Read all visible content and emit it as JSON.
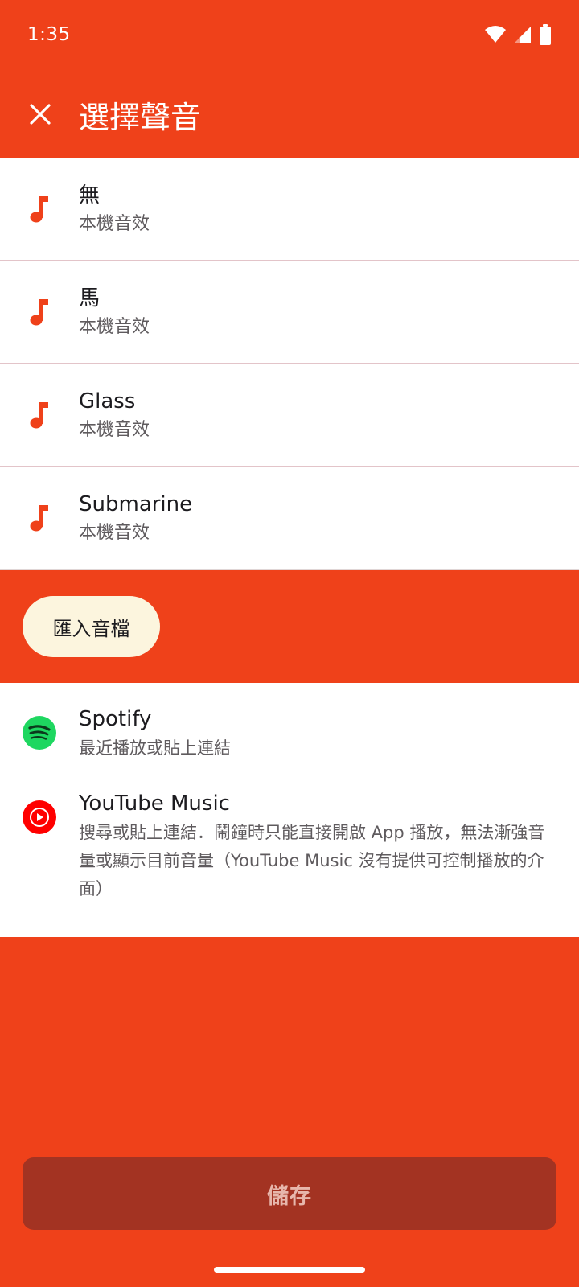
{
  "status_bar": {
    "time": "1:35"
  },
  "top_bar": {
    "title": "選擇聲音"
  },
  "sound_list": [
    {
      "title": "無",
      "subtitle": "本機音效"
    },
    {
      "title": "馬",
      "subtitle": "本機音效"
    },
    {
      "title": "Glass",
      "subtitle": "本機音效"
    },
    {
      "title": "Submarine",
      "subtitle": "本機音效"
    }
  ],
  "import_button": {
    "label": "匯入音檔"
  },
  "streaming": {
    "spotify": {
      "title": "Spotify",
      "subtitle": "最近播放或貼上連結"
    },
    "youtube_music": {
      "title": "YouTube Music",
      "subtitle": "搜尋或貼上連結．鬧鐘時只能直接開啟 App 播放，無法漸強音量或顯示目前音量（YouTube Music 沒有提供可控制播放的介面）"
    }
  },
  "save_button": {
    "label": "儲存"
  },
  "colors": {
    "primary": "#EF411A",
    "save_button": "#A33322",
    "import_button": "#FCF5DE",
    "spotify": "#1ED760",
    "youtube": "#FF0000"
  },
  "icons": {
    "close": "close-icon",
    "sound": "music-note-icon",
    "spotify": "spotify-icon",
    "youtube_music": "youtube-music-icon"
  }
}
